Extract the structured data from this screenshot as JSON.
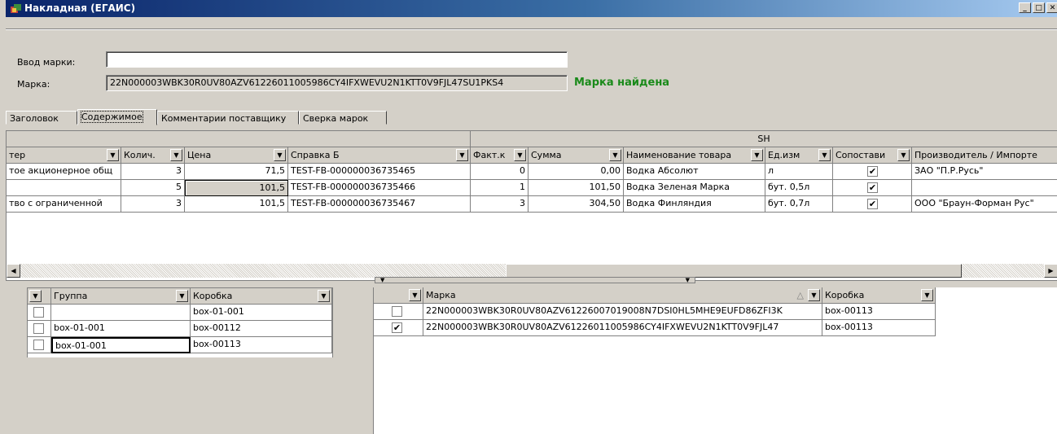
{
  "window": {
    "title": "Накладная (ЕГАИС)"
  },
  "form": {
    "input_label": "Ввод марки:",
    "input_value": "",
    "mark_label": "Марка:",
    "mark_value": "22N000003WBK30R0UV80AZV61226011005986CY4IFXWEVU2N1KTT0V9FJL47SU1PKS4",
    "status": "Марка найдена",
    "status_color": "#1a8a1a"
  },
  "tabs": [
    {
      "label": "Заголовок"
    },
    {
      "label": "Содержимое",
      "active": true
    },
    {
      "label": "Комментарии поставщику"
    },
    {
      "label": "Сверка марок"
    }
  ],
  "main_grid": {
    "group_header": "SH",
    "columns": [
      "тер",
      "Колич.",
      "Цена",
      "Справка Б",
      "Факт.к",
      "Сумма",
      "Наименование товара",
      "Ед.изм",
      "Сопостави",
      "Производитель / Импорте"
    ],
    "rows": [
      {
        "producer_short": "тое акционерное общ",
        "qty": "3",
        "price": "71,5",
        "ref": "TEST-FB-000000036735465",
        "fact": "0",
        "sum": "0,00",
        "name": "Водка Абсолют",
        "unit": "л",
        "matched": true,
        "producer": "ЗАО \"П.Р.Русь\""
      },
      {
        "producer_short": "",
        "qty": "5",
        "price": "101,5",
        "ref": "TEST-FB-000000036735466",
        "fact": "1",
        "sum": "101,50",
        "name": "Водка Зеленая Марка",
        "unit": "бут. 0,5л",
        "matched": true,
        "producer": ""
      },
      {
        "producer_short": "тво с ограниченной",
        "qty": "3",
        "price": "101,5",
        "ref": "TEST-FB-000000036735467",
        "fact": "3",
        "sum": "304,50",
        "name": "Водка Финляндия",
        "unit": "бут. 0,7л",
        "matched": true,
        "producer": "ООО \"Браун-Форман Рус\""
      }
    ]
  },
  "box_grid": {
    "columns": [
      "Группа",
      "Коробка"
    ],
    "rows": [
      {
        "checked": false,
        "group": "",
        "box": "box-01-001"
      },
      {
        "checked": false,
        "group": "box-01-001",
        "box": "box-00112"
      },
      {
        "checked": false,
        "group": "box-01-001",
        "box": "box-00113"
      }
    ]
  },
  "mark_grid": {
    "columns": [
      "Марка",
      "Коробка"
    ],
    "rows": [
      {
        "checked": false,
        "mark": "22N000003WBK30R0UV80AZV61226007019008N7DSI0HL5MHE9EUFD86ZFI3K",
        "box": "box-00113"
      },
      {
        "checked": true,
        "mark": "22N000003WBK30R0UV80AZV61226011005986CY4IFXWEVU2N1KTT0V9FJL47",
        "box": "box-00113"
      }
    ]
  },
  "icons": {
    "app": "app-icon",
    "dropdown": "dropdown-arrow-icon",
    "check": "checkmark-icon"
  }
}
